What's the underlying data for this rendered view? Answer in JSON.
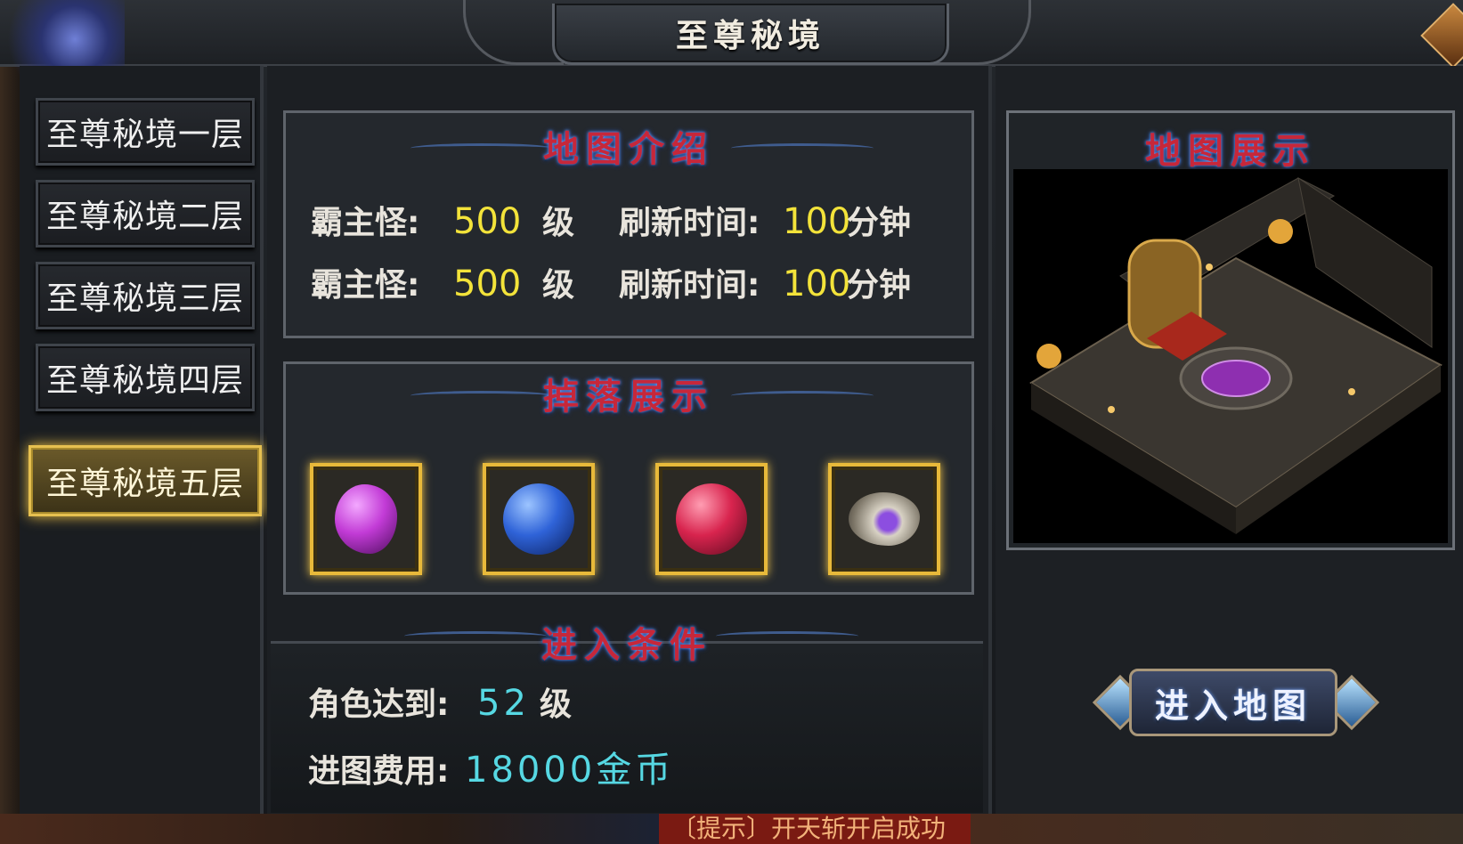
{
  "window": {
    "title": "至尊秘境"
  },
  "floors": [
    {
      "label": "至尊秘境一层"
    },
    {
      "label": "至尊秘境二层"
    },
    {
      "label": "至尊秘境三层"
    },
    {
      "label": "至尊秘境四层"
    },
    {
      "label": "至尊秘境五层"
    }
  ],
  "selected_floor_index": 4,
  "map_intro": {
    "title": "地图介绍",
    "rows": [
      {
        "boss_label": "霸主怪:",
        "boss_level": "500",
        "level_unit": "级",
        "refresh_label": "刷新时间:",
        "refresh_value": "100",
        "refresh_unit": "分钟"
      },
      {
        "boss_label": "霸主怪:",
        "boss_level": "500",
        "level_unit": "级",
        "refresh_label": "刷新时间:",
        "refresh_value": "100",
        "refresh_unit": "分钟"
      }
    ]
  },
  "drops": {
    "title": "掉落展示",
    "items": [
      {
        "icon": "purple-crystal-icon",
        "color": "#c23bd6"
      },
      {
        "icon": "blue-rune-stone-icon",
        "color": "#2f63d8"
      },
      {
        "icon": "red-rune-stone-icon",
        "color": "#d8244e"
      },
      {
        "icon": "silver-ore-with-gem-icon",
        "color": "#9a8fb2"
      }
    ]
  },
  "conditions": {
    "title": "进入条件",
    "level_label": "角色达到:",
    "level_value": "52",
    "level_unit": "级",
    "fee_label": "进图费用:",
    "fee_value": "18000金币"
  },
  "map_display": {
    "title": "地图展示"
  },
  "enter_button": {
    "label": "进入地图"
  },
  "notice": {
    "text": "〔提示〕开天斩开启成功"
  }
}
